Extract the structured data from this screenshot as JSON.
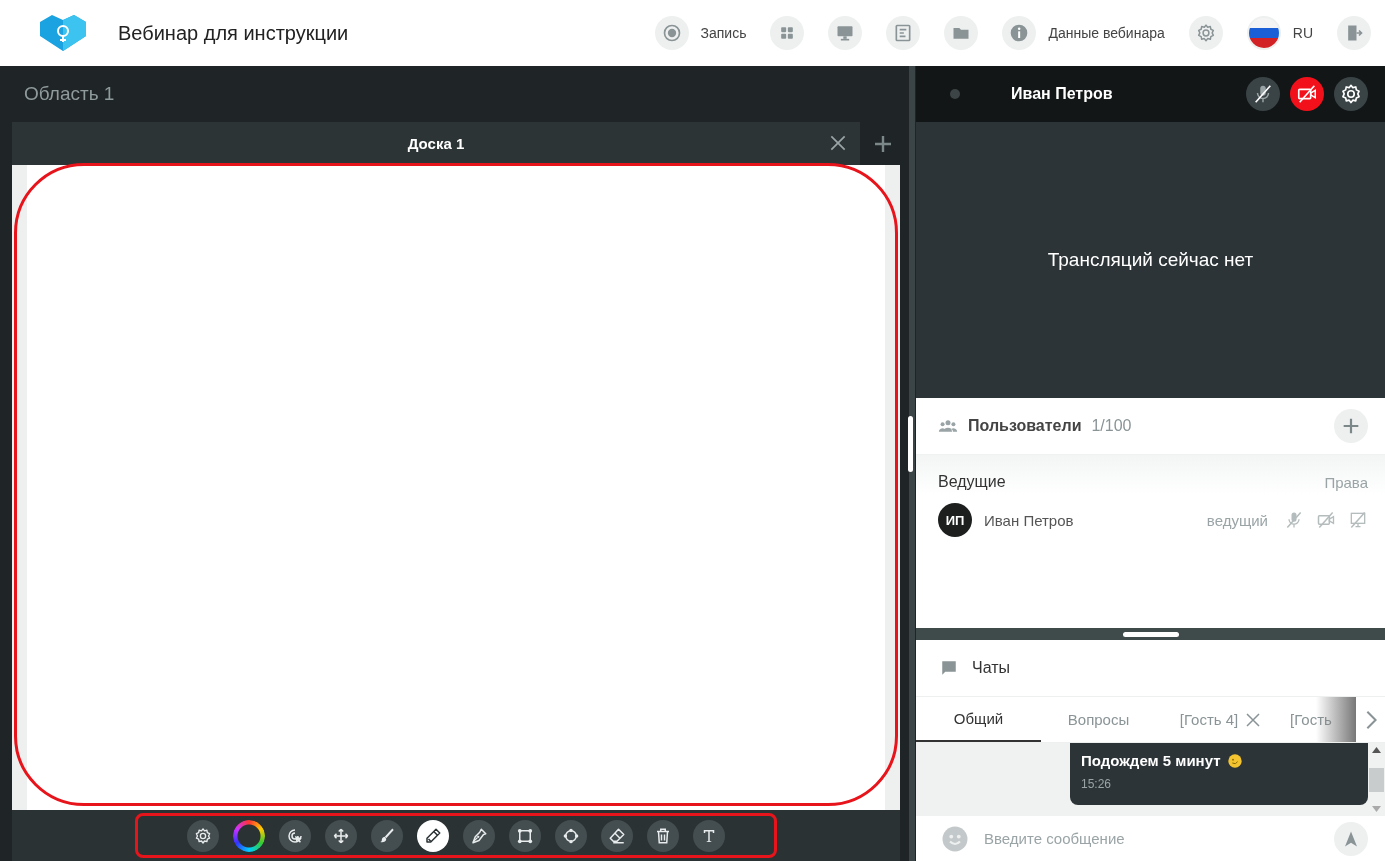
{
  "header": {
    "title": "Вебинар для инструкции",
    "actions": [
      {
        "kind": "record",
        "label": "Запись"
      },
      {
        "kind": "layout"
      },
      {
        "kind": "screen"
      },
      {
        "kind": "document"
      },
      {
        "kind": "folder"
      },
      {
        "kind": "info",
        "label": "Данные вебинара"
      },
      {
        "kind": "settings"
      },
      {
        "kind": "language",
        "label": "RU"
      },
      {
        "kind": "exit"
      }
    ]
  },
  "workspace": {
    "title": "Область 1",
    "highlighted": true,
    "tabs": [
      {
        "label": "Доска 1",
        "selected": true,
        "closable": true
      }
    ]
  },
  "toolbar": {
    "highlighted": true,
    "tools": [
      {
        "kind": "settings",
        "selected": false
      },
      {
        "kind": "color",
        "selected": false
      },
      {
        "kind": "select",
        "selected": false
      },
      {
        "kind": "move",
        "selected": false
      },
      {
        "kind": "brush",
        "selected": false
      },
      {
        "kind": "pencil",
        "selected": true
      },
      {
        "kind": "pen",
        "selected": false
      },
      {
        "kind": "rectangle",
        "selected": false
      },
      {
        "kind": "shape",
        "selected": false
      },
      {
        "kind": "eraser",
        "selected": false
      },
      {
        "kind": "trash",
        "selected": false
      },
      {
        "kind": "text",
        "selected": false
      }
    ]
  },
  "presenter": {
    "name": "Иван Петров",
    "video_message": "Трансляций сейчас нет",
    "controls": [
      {
        "kind": "mic",
        "alert": false
      },
      {
        "kind": "camera",
        "alert": true
      },
      {
        "kind": "settings",
        "alert": false
      }
    ]
  },
  "users": {
    "title": "Пользователи",
    "count": "1/100",
    "groups": [
      {
        "title": "Ведущие",
        "rights_label": "Права",
        "members": [
          {
            "initials": "ИП",
            "name": "Иван Петров",
            "role": "ведущий",
            "permissions": [
              {
                "kind": "mic",
                "enabled": false
              },
              {
                "kind": "camera",
                "enabled": false
              },
              {
                "kind": "screen",
                "enabled": false
              }
            ]
          }
        ]
      }
    ]
  },
  "chat": {
    "title": "Чаты",
    "tabs": [
      {
        "label": "Общий",
        "selected": true,
        "closable": false,
        "faded": false
      },
      {
        "label": "Вопросы",
        "selected": false,
        "closable": false,
        "faded": false
      },
      {
        "label": "[Гость 4]",
        "selected": false,
        "closable": true,
        "faded": false
      },
      {
        "label": "[Гость",
        "selected": false,
        "closable": false,
        "faded": true
      }
    ],
    "messages": [
      {
        "text": "Подождем 5 минут",
        "emoji": true,
        "time": "15:26"
      }
    ],
    "input": {
      "placeholder": "Введите сообщение"
    }
  }
}
